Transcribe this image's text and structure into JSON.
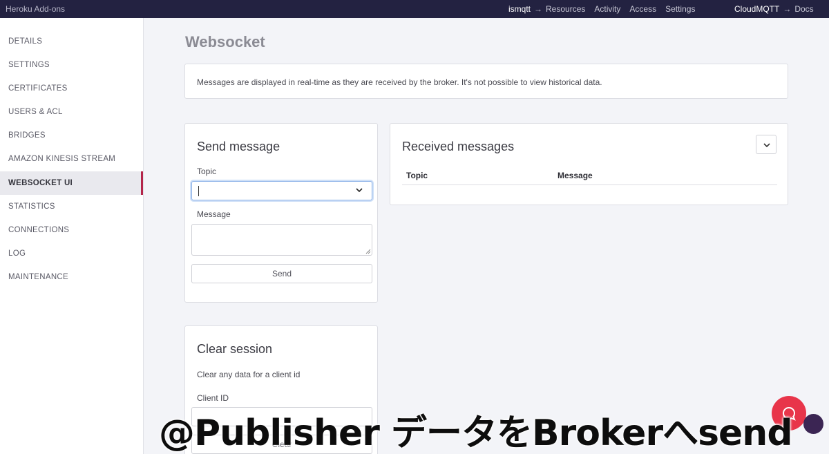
{
  "topbar": {
    "brand": "Heroku Add-ons",
    "app": "ismqtt",
    "links": [
      "Resources",
      "Activity",
      "Access",
      "Settings"
    ],
    "addon": "CloudMQTT",
    "docs": "Docs",
    "arrow": "→"
  },
  "sidebar": {
    "items": [
      {
        "label": "DETAILS"
      },
      {
        "label": "SETTINGS"
      },
      {
        "label": "CERTIFICATES"
      },
      {
        "label": "USERS & ACL"
      },
      {
        "label": "BRIDGES"
      },
      {
        "label": "AMAZON KINESIS STREAM"
      },
      {
        "label": "WEBSOCKET UI"
      },
      {
        "label": "STATISTICS"
      },
      {
        "label": "CONNECTIONS"
      },
      {
        "label": "LOG"
      },
      {
        "label": "MAINTENANCE"
      }
    ],
    "active": "WEBSOCKET UI"
  },
  "main": {
    "title": "Websocket",
    "notice": "Messages are displayed in real-time as they are received by the broker. It's not possible to view historical data.",
    "send": {
      "heading": "Send message",
      "topic_label": "Topic",
      "topic_value": "",
      "message_label": "Message",
      "message_value": "",
      "button": "Send"
    },
    "received": {
      "heading": "Received messages",
      "columns": [
        "Topic",
        "Message"
      ]
    },
    "clear": {
      "heading": "Clear session",
      "description": "Clear any data for a client id",
      "client_label": "Client ID",
      "client_value": "",
      "button": "Clear"
    }
  },
  "caption": "@Publisher データをBrokerへsend",
  "colors": {
    "topbar": "#232241",
    "active_accent": "#b4254a",
    "chat": "#e8354a",
    "focus": "#8fb3e8"
  },
  "icons": {
    "select": "chevron-down-icon",
    "collapse": "chevron-down-icon",
    "chat": "chat-bubble-icon"
  }
}
